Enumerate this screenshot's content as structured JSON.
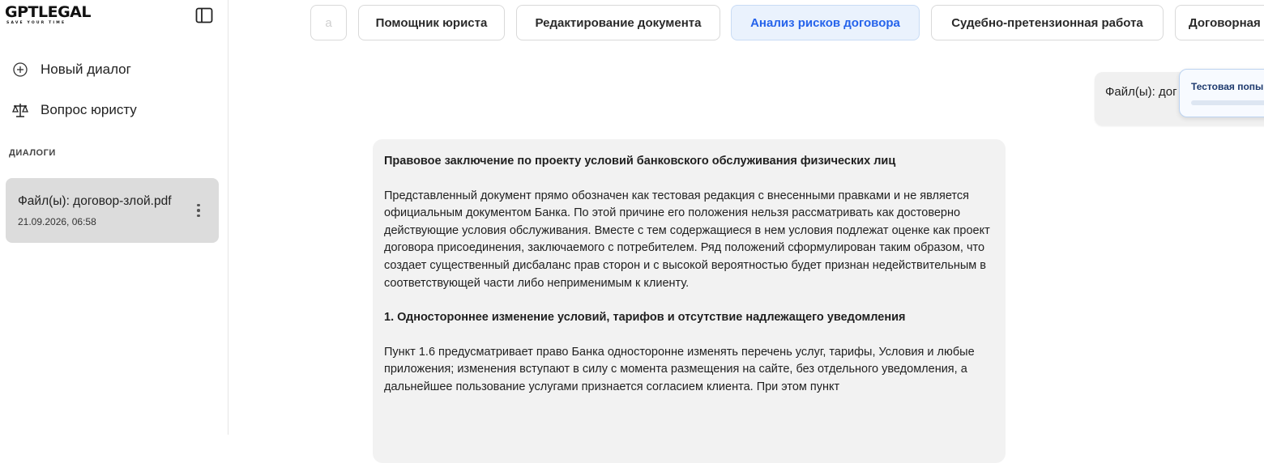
{
  "brand": {
    "name": "GPTLEGAL",
    "tagline": "SAVE YOUR TIME"
  },
  "sidebar": {
    "new_dialog": "Новый диалог",
    "ask_lawyer": "Вопрос юристу",
    "section_label": "ДИАЛОГИ",
    "dialogs": [
      {
        "title": "Файл(ы): договор-злой.pdf",
        "date": "21.09.2026, 06:58"
      }
    ]
  },
  "tabs": [
    {
      "label": "а",
      "state": "faded"
    },
    {
      "label": "Помощник юриста",
      "state": "normal"
    },
    {
      "label": "Редактирование документа",
      "state": "normal"
    },
    {
      "label": "Анализ рисков договора",
      "state": "active"
    },
    {
      "label": "Судебно-претензионная работа",
      "state": "normal"
    },
    {
      "label": "Договорная",
      "state": "normal"
    }
  ],
  "chat": {
    "user_message": "Файл(ы): дог",
    "toast_title": "Тестовая попы",
    "answer": {
      "title": "Правовое заключение по проекту условий банковского обслуживания физических лиц",
      "paragraph1": "Представленный документ прямо обозначен как тестовая редакция с внесенными правками и не является официальным документом Банка. По этой причине его положения нельзя рассматривать как достоверно действующие условия обслуживания. Вместе с тем содержащиеся в нем условия подлежат оценке как проект договора присоединения, заключаемого с потребителем. Ряд положений сформулирован таким образом, что создает существенный дисбаланс прав сторон и с высокой вероятностью будет признан недействительным в соответствующей части либо неприменимым к клиенту.",
      "heading1": "1. Одностороннее изменение условий, тарифов и отсутствие надлежащего уведомления",
      "paragraph2": "Пункт 1.6 предусматривает право Банка односторонне изменять перечень услуг, тарифы, Условия и любые приложения; изменения вступают в силу с момента размещения на сайте, без отдельного уведомления, а дальнейшее пользование услугами признается согласием клиента. При этом пункт"
    }
  },
  "colors": {
    "accent": "#2563eb",
    "active_tab_bg": "#eaf2fd",
    "dialog_bg": "#dcdcdc",
    "answer_bg": "#f2f2f2"
  }
}
